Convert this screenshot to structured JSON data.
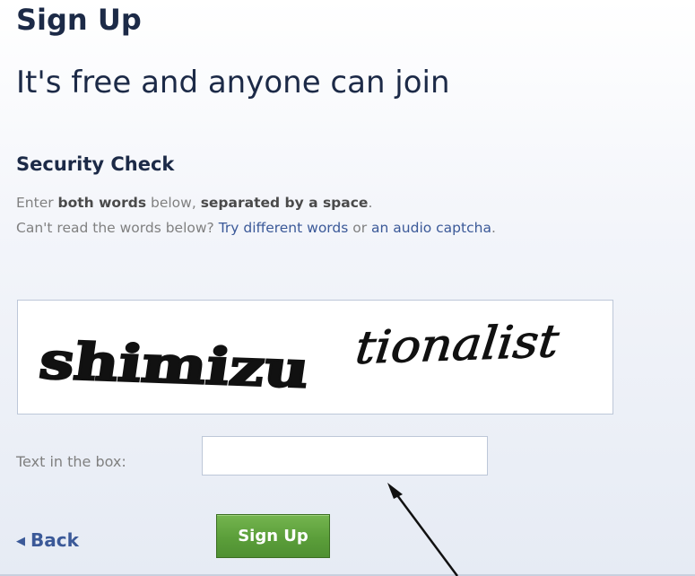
{
  "header": {
    "title": "Sign Up",
    "subtitle": "It's free and anyone can join"
  },
  "security_check": {
    "title": "Security Check",
    "line1": {
      "t1": "Enter ",
      "b1": "both words",
      "t2": " below, ",
      "b2": "separated by a space",
      "t3": "."
    },
    "line2": {
      "t1": "Can't read the words below? ",
      "link1": "Try different words",
      "t2": " or ",
      "link2": "an audio captcha",
      "t3": "."
    },
    "captcha": {
      "word1": "shimizu",
      "word2": "tionalist"
    }
  },
  "form": {
    "field_label": "Text in the box:",
    "field_value": ""
  },
  "actions": {
    "back_label": "Back",
    "back_icon": "triangle-left-icon",
    "signup_label": "Sign Up"
  },
  "colors": {
    "heading": "#1c2a47",
    "link": "#3b5998",
    "button_green": "#5b9e3a",
    "border": "#bdc7d8"
  }
}
